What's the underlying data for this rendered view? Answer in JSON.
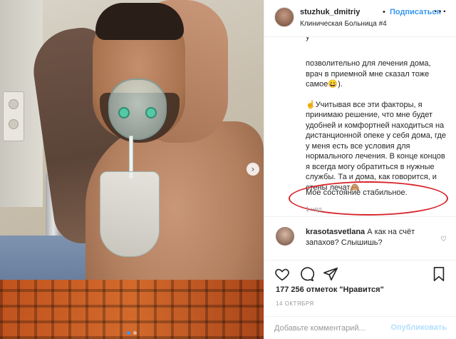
{
  "post": {
    "username": "stuzhuk_dmitriy",
    "separator": "•",
    "follow_label": "Подписаться",
    "location": "Клиническая Больница #4",
    "more_label": "···",
    "carousel_next": "›",
    "caption_cut": "у",
    "caption_paragraphs": [
      "позволительно для лечения дома, врач в приемной мне сказал тоже самое😄).",
      "☝️Учитывая все эти факторы, я принимаю решение, что мне будет удобней и комфортней находиться на дистанционной опеке у себя дома, где у меня есть все условия для нормального лечения. В конце концов я всегда могу обратиться в нужные службы. Та и дома, как говорится, и стены лечат🙈"
    ],
    "status_line": "Мое состояние стабильное.",
    "time_ago": "1 нед.",
    "comment": {
      "username": "krasotasvetlana",
      "text": "А как на счёт запахов? Слышишь?",
      "heart": "♡"
    },
    "likes": "177 256 отметок \"Нравится\"",
    "date": "14 ОКТЯБРЯ",
    "comment_placeholder": "Добавьте комментарий...",
    "publish_label": "Опубликовать",
    "icons": [
      "heart-icon",
      "comment-icon",
      "share-icon",
      "bookmark-icon"
    ],
    "accent_color": "#3897f0",
    "highlight_color": "#d8262b"
  }
}
